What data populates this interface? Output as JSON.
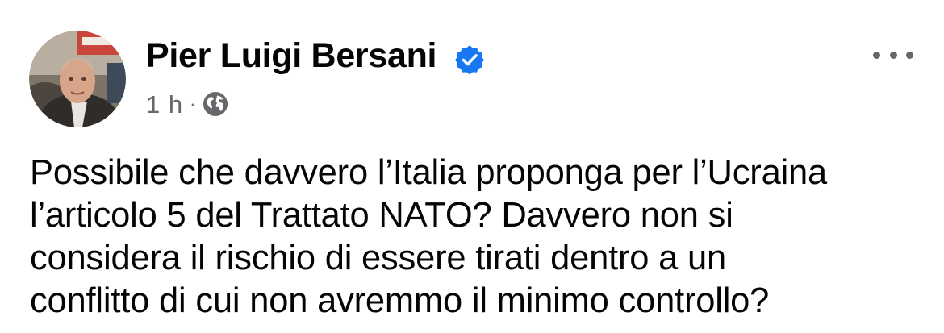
{
  "post": {
    "author": {
      "name": "Pier Luigi Bersani",
      "verified_icon": "verified-badge-icon",
      "avatar_icon": "profile-photo"
    },
    "meta": {
      "time": "1 h",
      "separator": "·",
      "audience_icon": "globe-icon"
    },
    "more_icon": "more-options-icon",
    "text_lines": [
      "Possibile che davvero l’Italia proponga per l’Ucraina",
      "l’articolo 5 del Trattato NATO? Davvero non si",
      "considera il rischio di essere tirati dentro a un",
      "conflitto di cui non avremmo il minimo controllo?"
    ]
  },
  "colors": {
    "text": "#050505",
    "secondary": "#65676b",
    "verified": "#1877f2"
  }
}
